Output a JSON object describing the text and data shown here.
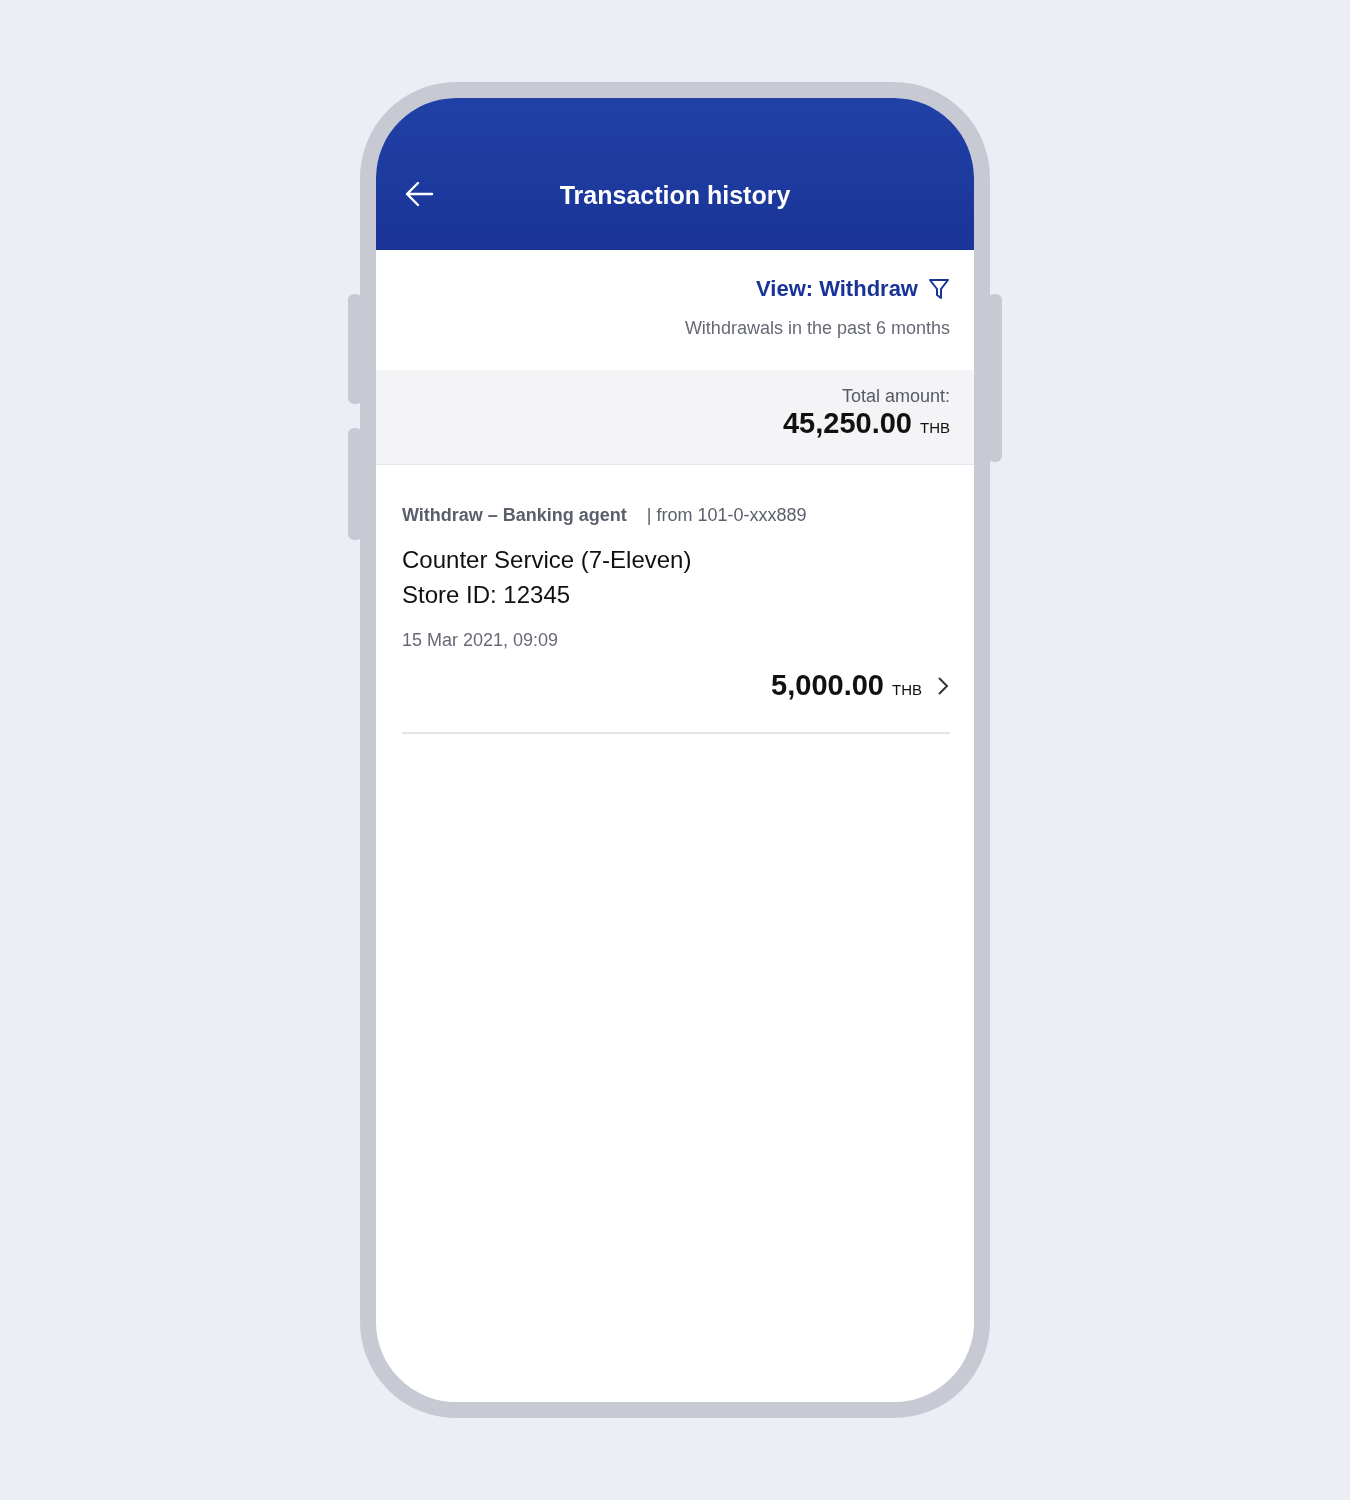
{
  "header": {
    "title": "Transaction history"
  },
  "filter": {
    "label": "View: Withdraw",
    "subtitle": "Withdrawals in the past 6 months"
  },
  "total": {
    "label": "Total amount:",
    "amount": "45,250.00",
    "currency": "THB"
  },
  "transactions": [
    {
      "type": "Withdraw – Banking agent",
      "source": "| from 101-0-xxx889",
      "name": "Counter Service (7-Eleven)",
      "store": "Store ID: 12345",
      "date": "15 Mar 2021, 09:09",
      "amount": "5,000.00",
      "currency": "THB"
    }
  ]
}
